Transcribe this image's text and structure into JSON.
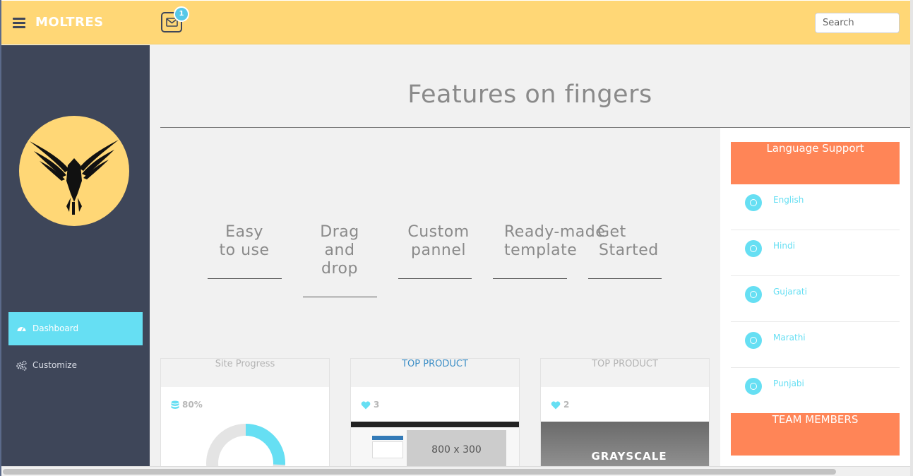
{
  "header": {
    "brand": "MOLTRES",
    "notification_count": "1",
    "search_placeholder": "Search"
  },
  "sidebar": {
    "items": [
      {
        "label": "Dashboard",
        "icon": "dashboard-icon",
        "active": true
      },
      {
        "label": "Customize",
        "icon": "gears-icon",
        "active": false
      }
    ]
  },
  "main": {
    "title": "Features on fingers",
    "features": [
      {
        "line1": "Easy",
        "line2": "to use",
        "line3": ""
      },
      {
        "line1": "Drag",
        "line2": "and",
        "line3": "drop"
      },
      {
        "line1": "Custom",
        "line2": "pannel",
        "line3": ""
      },
      {
        "line1": "Ready-made",
        "line2": "template",
        "line3": ""
      },
      {
        "line1": "Get",
        "line2": "Started",
        "line3": ""
      }
    ],
    "cards": [
      {
        "title": "Site Progress",
        "stat": "80%",
        "progress": 0.8
      },
      {
        "title": "TOP PRODUCT",
        "stat": "3",
        "placeholder": "800 x 300"
      },
      {
        "title": "TOP PRODUCT",
        "stat": "2",
        "banner": "GRAYSCALE"
      }
    ]
  },
  "right_panel": {
    "language_title": "Language Support",
    "languages": [
      "English",
      "Hindi",
      "Gujarati",
      "Marathi",
      "Punjabi"
    ],
    "team_title": "TEAM MEMBERS"
  },
  "colors": {
    "topbar": "#ffd776",
    "sidebar": "#3e4659",
    "accent": "#66dff3",
    "orange": "#ff8557"
  }
}
